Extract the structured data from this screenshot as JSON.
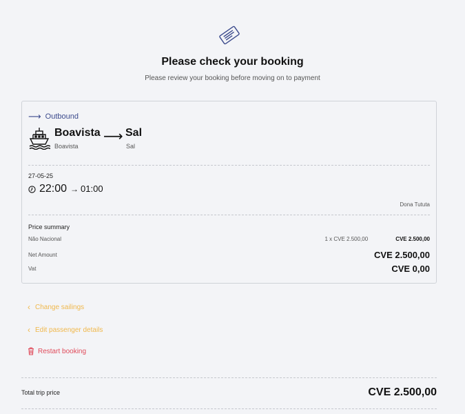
{
  "header": {
    "icon": "ticket-icon",
    "title": "Please check your booking",
    "subtitle": "Please review your booking before moving on to payment"
  },
  "trip": {
    "direction_label": "Outbound",
    "from_city": "Boavista",
    "from_port": "Boavista",
    "to_city": "Sal",
    "to_port": "Sal",
    "date": "27-05-25",
    "departure_time": "22:00",
    "arrival_time": "01:00",
    "vessel": "Dona Tututa"
  },
  "price": {
    "heading": "Price summary",
    "fare_label": "Não Nacional",
    "fare_qty": "1 x CVE 2.500,00",
    "fare_amount": "CVE 2.500,00",
    "net_label": "Net Amount",
    "net_amount": "CVE 2.500,00",
    "vat_label": "Vat",
    "vat_amount": "CVE 0,00"
  },
  "actions": {
    "change_sailings": "Change sailings",
    "edit_passenger": "Edit passenger details",
    "restart": "Restart booking"
  },
  "total": {
    "label": "Total trip price",
    "amount": "CVE 2.500,00"
  },
  "colors": {
    "accent_blue": "#3b4a8c",
    "link_yellow": "#f0b84c",
    "danger_red": "#e04a5a"
  }
}
